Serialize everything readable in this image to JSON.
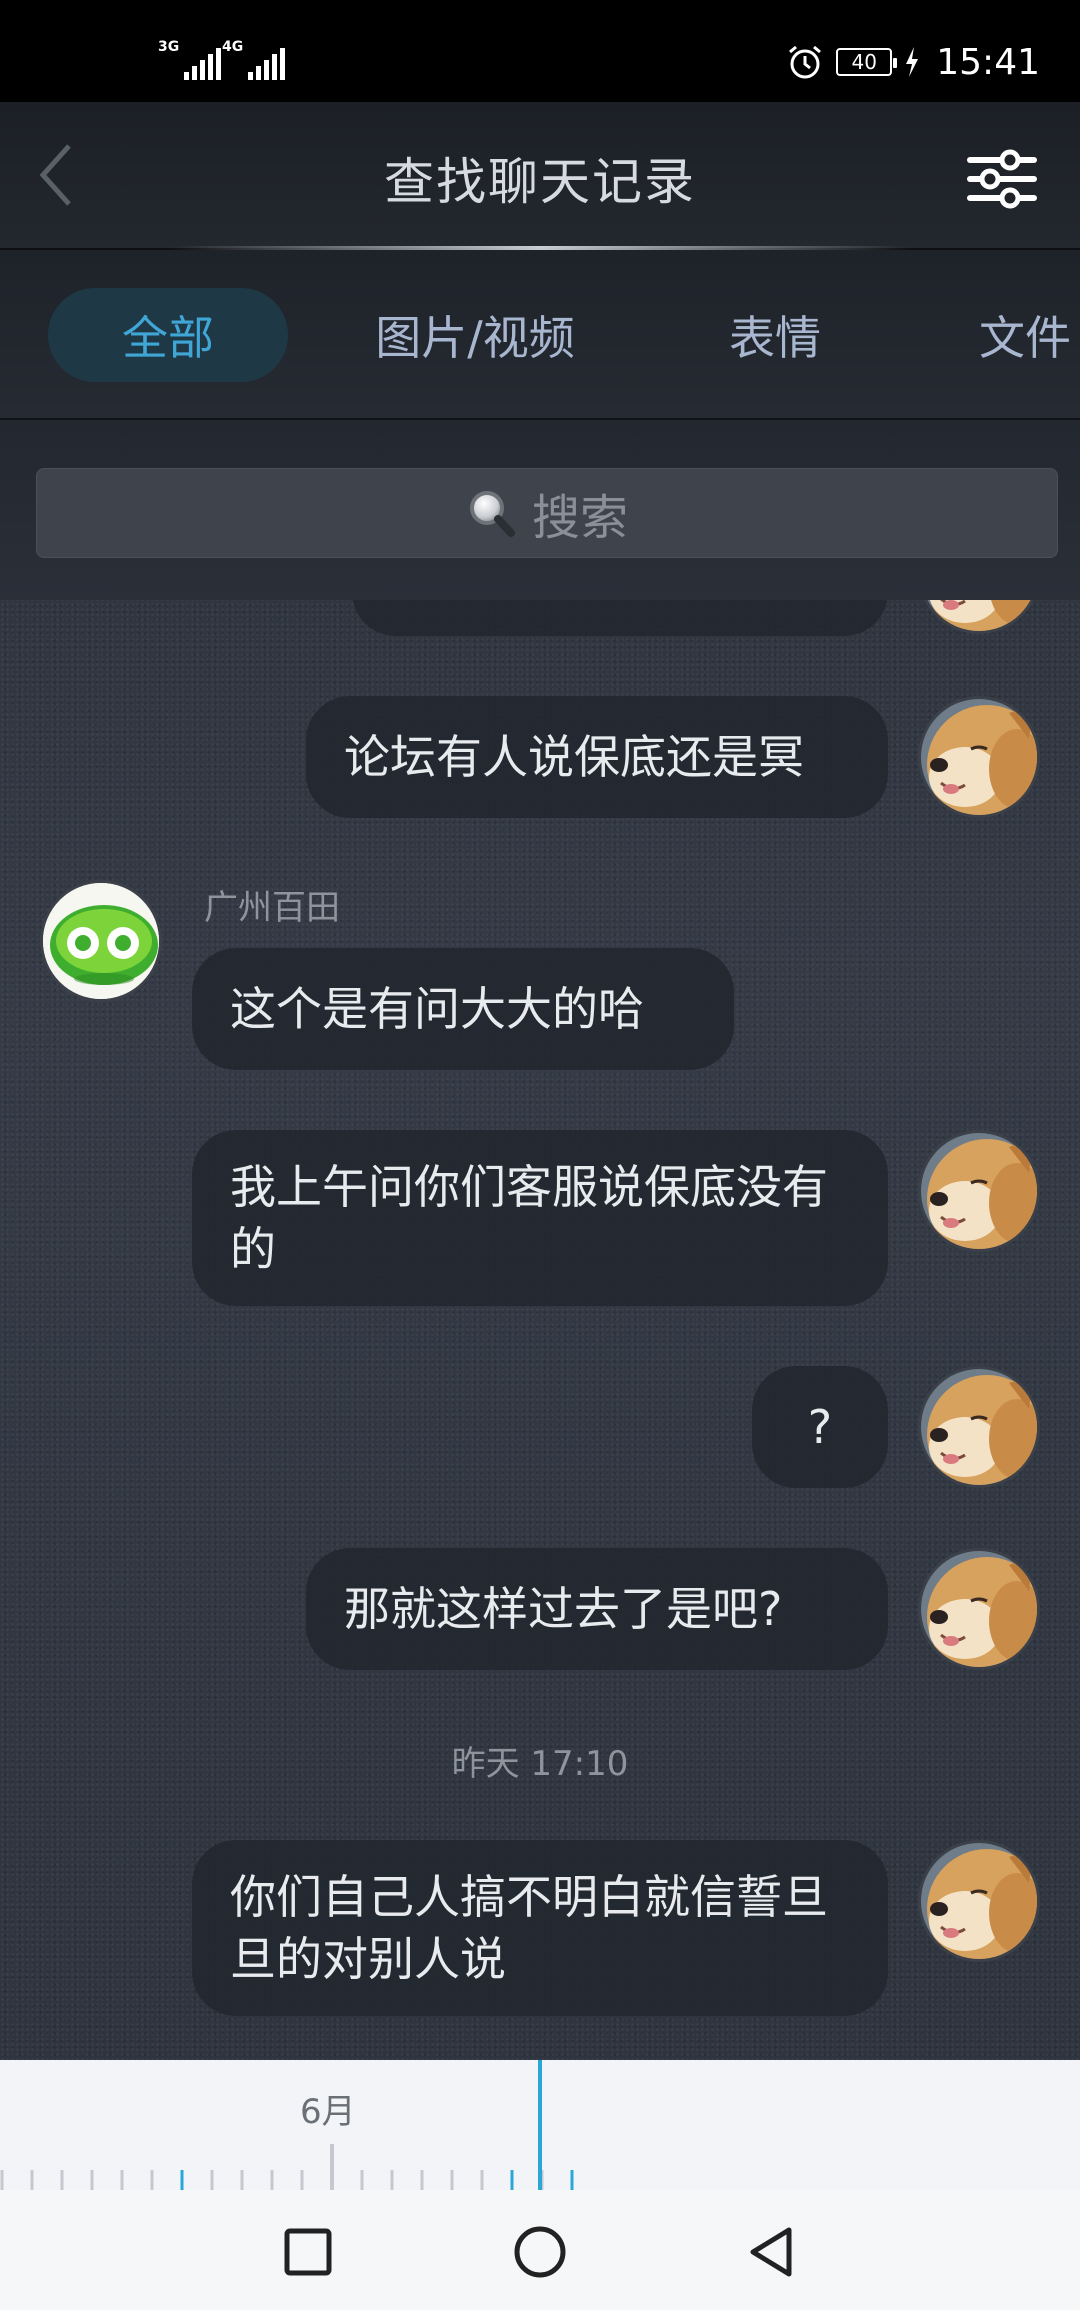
{
  "status_bar": {
    "signal1_label": "3G",
    "signal2_label": "4G",
    "battery": "40",
    "time": "15:41"
  },
  "header": {
    "title": "查找聊天记录",
    "back_icon": "chevron-left-icon",
    "filter_icon": "sliders-icon"
  },
  "tabs": [
    {
      "label": "全部",
      "active": true
    },
    {
      "label": "图片/视频",
      "active": false
    },
    {
      "label": "表情",
      "active": false
    },
    {
      "label": "文件",
      "active": false
    }
  ],
  "search": {
    "placeholder": "搜索",
    "icon": "search-icon"
  },
  "messages": [
    {
      "side": "right",
      "text": "论坛有人说保底还是冥"
    },
    {
      "side": "left",
      "sender": "广州百田",
      "text": "这个是有问大大的哈"
    },
    {
      "side": "right",
      "text": "我上午问你们客服说保底没有的"
    },
    {
      "side": "right",
      "text": "?"
    },
    {
      "side": "right",
      "text": "那就这样过去了是吧?"
    },
    {
      "side": "right",
      "text": "你们自己人搞不明白就信誓旦旦的对别人说"
    }
  ],
  "time_divider": "昨天 17:10",
  "timeline": {
    "month_label": "6月"
  },
  "colors": {
    "accent": "#3fa6d6",
    "timeline_cursor": "#29a8d8",
    "bubble": "#23282f"
  }
}
